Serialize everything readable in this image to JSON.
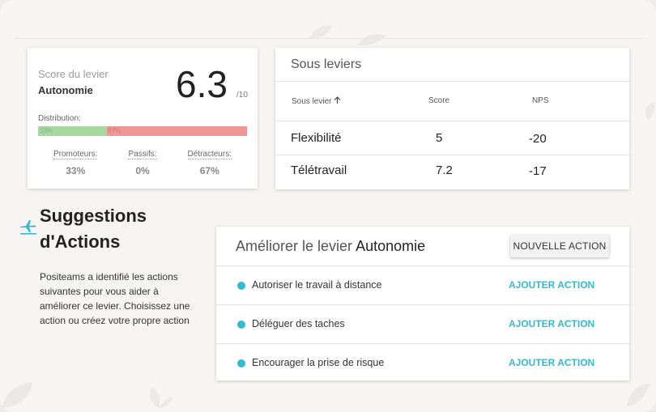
{
  "colors": {
    "accent": "#35b9cf",
    "promoters": "#a6d7a1",
    "detractors": "#ef9797",
    "background": "#f6f5f3"
  },
  "score_card": {
    "label": "Score du levier",
    "lever_name": "Autonomie",
    "score": "6.3",
    "max": "/10",
    "distribution_label": "Distribution:",
    "distribution": {
      "promoters_pct_label": "33%",
      "detractors_pct_label": "67%",
      "promoters_fraction": 0.33,
      "passives_fraction": 0.0,
      "detractors_fraction": 0.67
    },
    "stats": [
      {
        "title": "Promoteurs:",
        "value": "33%"
      },
      {
        "title": "Passifs:",
        "value": "0%"
      },
      {
        "title": "Détracteurs:",
        "value": "67%"
      }
    ]
  },
  "sub_levers": {
    "title": "Sous leviers",
    "columns": {
      "name": "Sous levier",
      "sort_icon": "arrow-up-icon",
      "score": "Score",
      "nps": "NPS"
    },
    "rows": [
      {
        "name": "Flexibilité",
        "score": "5",
        "nps": "-20"
      },
      {
        "name": "Télétravail",
        "score": "7.2",
        "nps": "-17"
      }
    ]
  },
  "suggestions": {
    "icon": "plane-icon",
    "title_line1": "Suggestions",
    "title_line2": "d'Actions",
    "description": "Positeams a identifié les actions suivantes pour vous aider à améliorer ce levier. Choisissez une action ou créez votre propre action"
  },
  "actions": {
    "title_prefix": "Améliorer le levier",
    "title_lever": "Autonomie",
    "new_action_label": "NOUVELLE ACTION",
    "add_label": "AJOUTER ACTION",
    "items": [
      {
        "label": "Autoriser le travail à distance"
      },
      {
        "label": "Déléguer des taches"
      },
      {
        "label": "Encourager la prise de risque"
      }
    ]
  }
}
